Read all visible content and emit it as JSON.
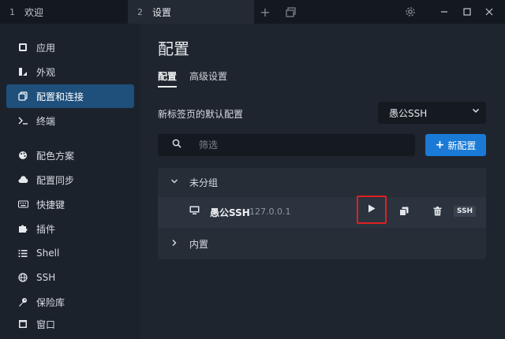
{
  "tabs": [
    {
      "num": "1",
      "label": "欢迎"
    },
    {
      "num": "2",
      "label": "设置"
    }
  ],
  "sidebar": {
    "items": [
      {
        "label": "应用",
        "icon": "app-icon"
      },
      {
        "label": "外观",
        "icon": "brush-icon"
      },
      {
        "label": "配置和连接",
        "icon": "profiles-icon",
        "active": true
      },
      {
        "label": "终端",
        "icon": "terminal-icon"
      },
      {
        "label": "配色方案",
        "icon": "palette-icon"
      },
      {
        "label": "配置同步",
        "icon": "cloud-icon"
      },
      {
        "label": "快捷键",
        "icon": "keyboard-icon"
      },
      {
        "label": "插件",
        "icon": "puzzle-icon"
      },
      {
        "label": "Shell",
        "icon": "list-icon"
      },
      {
        "label": "SSH",
        "icon": "globe-icon"
      },
      {
        "label": "保险库",
        "icon": "key-icon"
      },
      {
        "label": "窗口",
        "icon": "window-icon"
      }
    ]
  },
  "main": {
    "title": "配置",
    "subtabs": [
      "配置",
      "高级设置"
    ],
    "default_profile_label": "新标签页的默认配置",
    "default_profile_value": "愚公SSH",
    "search_placeholder": "筛选",
    "new_button": "新配置",
    "new_button_icon": "+",
    "groups": [
      {
        "label": "未分组",
        "expanded": true
      },
      {
        "label": "内置",
        "expanded": false
      }
    ],
    "profile": {
      "name": "愚公SSH",
      "host": "127.0.0.1",
      "badge": "SSH"
    }
  },
  "colors": {
    "accent": "#1a7ad6",
    "active_nav": "#1f4f7b",
    "highlight": "#e02020"
  }
}
